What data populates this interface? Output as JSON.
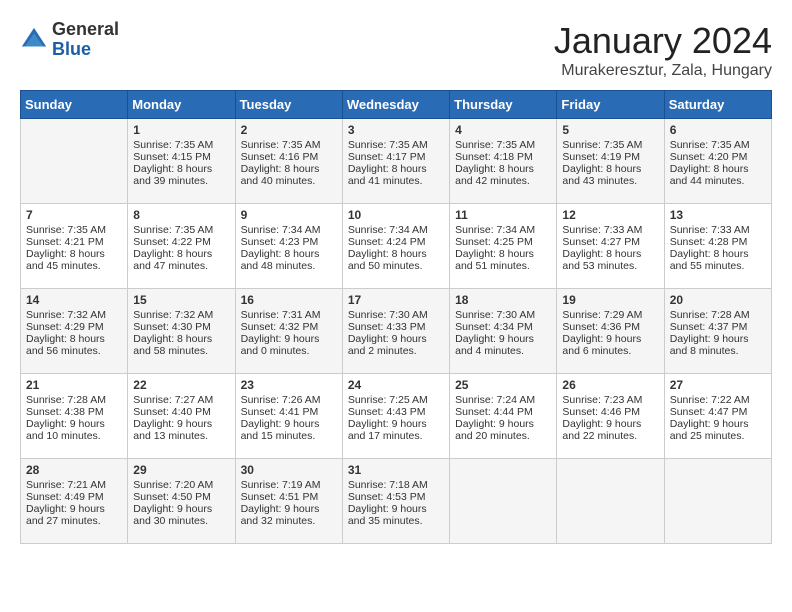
{
  "header": {
    "logo_general": "General",
    "logo_blue": "Blue",
    "month_title": "January 2024",
    "location": "Murakeresztur, Zala, Hungary"
  },
  "days_of_week": [
    "Sunday",
    "Monday",
    "Tuesday",
    "Wednesday",
    "Thursday",
    "Friday",
    "Saturday"
  ],
  "weeks": [
    [
      {
        "day": "",
        "sunrise": "",
        "sunset": "",
        "daylight": ""
      },
      {
        "day": "1",
        "sunrise": "Sunrise: 7:35 AM",
        "sunset": "Sunset: 4:15 PM",
        "daylight": "Daylight: 8 hours and 39 minutes."
      },
      {
        "day": "2",
        "sunrise": "Sunrise: 7:35 AM",
        "sunset": "Sunset: 4:16 PM",
        "daylight": "Daylight: 8 hours and 40 minutes."
      },
      {
        "day": "3",
        "sunrise": "Sunrise: 7:35 AM",
        "sunset": "Sunset: 4:17 PM",
        "daylight": "Daylight: 8 hours and 41 minutes."
      },
      {
        "day": "4",
        "sunrise": "Sunrise: 7:35 AM",
        "sunset": "Sunset: 4:18 PM",
        "daylight": "Daylight: 8 hours and 42 minutes."
      },
      {
        "day": "5",
        "sunrise": "Sunrise: 7:35 AM",
        "sunset": "Sunset: 4:19 PM",
        "daylight": "Daylight: 8 hours and 43 minutes."
      },
      {
        "day": "6",
        "sunrise": "Sunrise: 7:35 AM",
        "sunset": "Sunset: 4:20 PM",
        "daylight": "Daylight: 8 hours and 44 minutes."
      }
    ],
    [
      {
        "day": "7",
        "sunrise": "Sunrise: 7:35 AM",
        "sunset": "Sunset: 4:21 PM",
        "daylight": "Daylight: 8 hours and 45 minutes."
      },
      {
        "day": "8",
        "sunrise": "Sunrise: 7:35 AM",
        "sunset": "Sunset: 4:22 PM",
        "daylight": "Daylight: 8 hours and 47 minutes."
      },
      {
        "day": "9",
        "sunrise": "Sunrise: 7:34 AM",
        "sunset": "Sunset: 4:23 PM",
        "daylight": "Daylight: 8 hours and 48 minutes."
      },
      {
        "day": "10",
        "sunrise": "Sunrise: 7:34 AM",
        "sunset": "Sunset: 4:24 PM",
        "daylight": "Daylight: 8 hours and 50 minutes."
      },
      {
        "day": "11",
        "sunrise": "Sunrise: 7:34 AM",
        "sunset": "Sunset: 4:25 PM",
        "daylight": "Daylight: 8 hours and 51 minutes."
      },
      {
        "day": "12",
        "sunrise": "Sunrise: 7:33 AM",
        "sunset": "Sunset: 4:27 PM",
        "daylight": "Daylight: 8 hours and 53 minutes."
      },
      {
        "day": "13",
        "sunrise": "Sunrise: 7:33 AM",
        "sunset": "Sunset: 4:28 PM",
        "daylight": "Daylight: 8 hours and 55 minutes."
      }
    ],
    [
      {
        "day": "14",
        "sunrise": "Sunrise: 7:32 AM",
        "sunset": "Sunset: 4:29 PM",
        "daylight": "Daylight: 8 hours and 56 minutes."
      },
      {
        "day": "15",
        "sunrise": "Sunrise: 7:32 AM",
        "sunset": "Sunset: 4:30 PM",
        "daylight": "Daylight: 8 hours and 58 minutes."
      },
      {
        "day": "16",
        "sunrise": "Sunrise: 7:31 AM",
        "sunset": "Sunset: 4:32 PM",
        "daylight": "Daylight: 9 hours and 0 minutes."
      },
      {
        "day": "17",
        "sunrise": "Sunrise: 7:30 AM",
        "sunset": "Sunset: 4:33 PM",
        "daylight": "Daylight: 9 hours and 2 minutes."
      },
      {
        "day": "18",
        "sunrise": "Sunrise: 7:30 AM",
        "sunset": "Sunset: 4:34 PM",
        "daylight": "Daylight: 9 hours and 4 minutes."
      },
      {
        "day": "19",
        "sunrise": "Sunrise: 7:29 AM",
        "sunset": "Sunset: 4:36 PM",
        "daylight": "Daylight: 9 hours and 6 minutes."
      },
      {
        "day": "20",
        "sunrise": "Sunrise: 7:28 AM",
        "sunset": "Sunset: 4:37 PM",
        "daylight": "Daylight: 9 hours and 8 minutes."
      }
    ],
    [
      {
        "day": "21",
        "sunrise": "Sunrise: 7:28 AM",
        "sunset": "Sunset: 4:38 PM",
        "daylight": "Daylight: 9 hours and 10 minutes."
      },
      {
        "day": "22",
        "sunrise": "Sunrise: 7:27 AM",
        "sunset": "Sunset: 4:40 PM",
        "daylight": "Daylight: 9 hours and 13 minutes."
      },
      {
        "day": "23",
        "sunrise": "Sunrise: 7:26 AM",
        "sunset": "Sunset: 4:41 PM",
        "daylight": "Daylight: 9 hours and 15 minutes."
      },
      {
        "day": "24",
        "sunrise": "Sunrise: 7:25 AM",
        "sunset": "Sunset: 4:43 PM",
        "daylight": "Daylight: 9 hours and 17 minutes."
      },
      {
        "day": "25",
        "sunrise": "Sunrise: 7:24 AM",
        "sunset": "Sunset: 4:44 PM",
        "daylight": "Daylight: 9 hours and 20 minutes."
      },
      {
        "day": "26",
        "sunrise": "Sunrise: 7:23 AM",
        "sunset": "Sunset: 4:46 PM",
        "daylight": "Daylight: 9 hours and 22 minutes."
      },
      {
        "day": "27",
        "sunrise": "Sunrise: 7:22 AM",
        "sunset": "Sunset: 4:47 PM",
        "daylight": "Daylight: 9 hours and 25 minutes."
      }
    ],
    [
      {
        "day": "28",
        "sunrise": "Sunrise: 7:21 AM",
        "sunset": "Sunset: 4:49 PM",
        "daylight": "Daylight: 9 hours and 27 minutes."
      },
      {
        "day": "29",
        "sunrise": "Sunrise: 7:20 AM",
        "sunset": "Sunset: 4:50 PM",
        "daylight": "Daylight: 9 hours and 30 minutes."
      },
      {
        "day": "30",
        "sunrise": "Sunrise: 7:19 AM",
        "sunset": "Sunset: 4:51 PM",
        "daylight": "Daylight: 9 hours and 32 minutes."
      },
      {
        "day": "31",
        "sunrise": "Sunrise: 7:18 AM",
        "sunset": "Sunset: 4:53 PM",
        "daylight": "Daylight: 9 hours and 35 minutes."
      },
      {
        "day": "",
        "sunrise": "",
        "sunset": "",
        "daylight": ""
      },
      {
        "day": "",
        "sunrise": "",
        "sunset": "",
        "daylight": ""
      },
      {
        "day": "",
        "sunrise": "",
        "sunset": "",
        "daylight": ""
      }
    ]
  ]
}
